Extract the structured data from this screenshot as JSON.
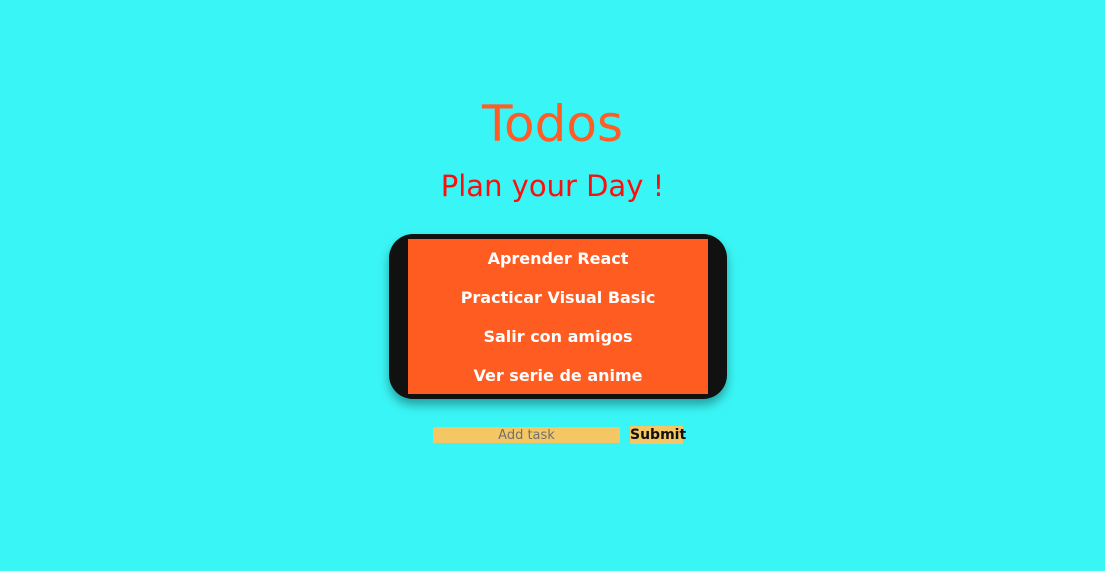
{
  "header": {
    "title": "Todos",
    "subtitle": "Plan your Day !"
  },
  "todos": {
    "items": [
      {
        "label": "Aprender React"
      },
      {
        "label": "Practicar Visual Basic"
      },
      {
        "label": "Salir con amigos"
      },
      {
        "label": "Ver serie de anime"
      }
    ]
  },
  "form": {
    "input_value": "",
    "input_placeholder": "Add task",
    "submit_label": "Submit"
  },
  "colors": {
    "background": "#3af5f5",
    "title": "#ff5c26",
    "subtitle": "#ff0d0d",
    "list_background": "#ff5c22",
    "list_frame": "#111111",
    "form_controls": "#f5c764"
  }
}
